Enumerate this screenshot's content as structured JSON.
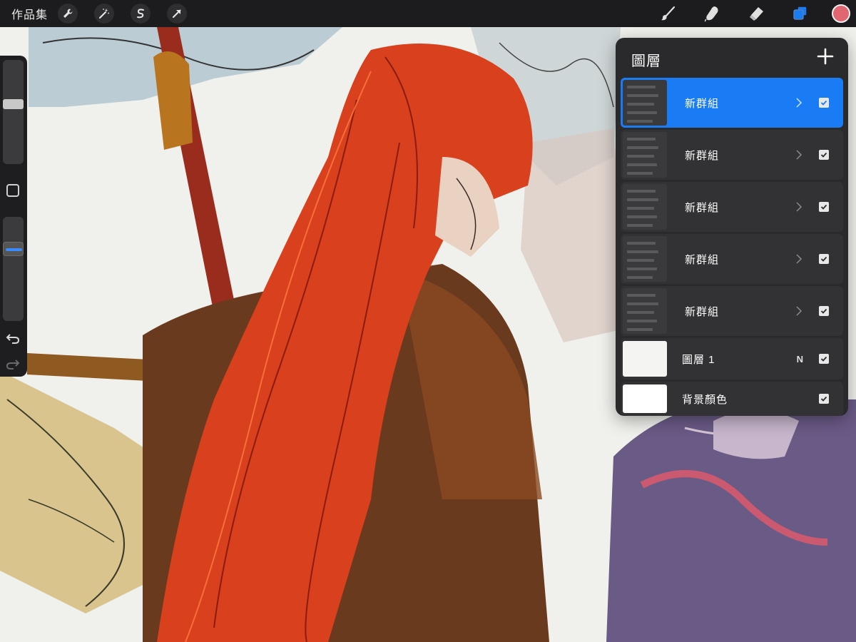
{
  "app": {
    "gallery_label": "作品集",
    "tools_left": [
      {
        "icon": "wrench-icon",
        "name": "actions"
      },
      {
        "icon": "magic-wand-icon",
        "name": "adjustments"
      },
      {
        "icon": "selection-s-icon",
        "name": "selection"
      },
      {
        "icon": "arrow-cursor-icon",
        "name": "transform"
      }
    ],
    "tools_right": [
      {
        "icon": "brush-icon",
        "name": "paint"
      },
      {
        "icon": "smudge-icon",
        "name": "smudge"
      },
      {
        "icon": "eraser-icon",
        "name": "erase"
      },
      {
        "icon": "layers-icon",
        "name": "layers"
      }
    ],
    "current_color": "#e06670",
    "accent_color": "#1a7cf5"
  },
  "sidebar": {
    "brush_size_level": 0.58,
    "opacity_level": 0.31
  },
  "layers_panel": {
    "title": "圖層",
    "layers": [
      {
        "name": "新群組",
        "type": "group",
        "selected": true,
        "visible": true
      },
      {
        "name": "新群組",
        "type": "group",
        "selected": false,
        "visible": true
      },
      {
        "name": "新群組",
        "type": "group",
        "selected": false,
        "visible": true
      },
      {
        "name": "新群組",
        "type": "group",
        "selected": false,
        "visible": true
      },
      {
        "name": "新群組",
        "type": "group",
        "selected": false,
        "visible": true
      },
      {
        "name": "圖層 1",
        "type": "layer",
        "blend": "N",
        "selected": false,
        "visible": true
      },
      {
        "name": "背景顏色",
        "type": "background",
        "selected": false,
        "visible": true
      }
    ]
  }
}
